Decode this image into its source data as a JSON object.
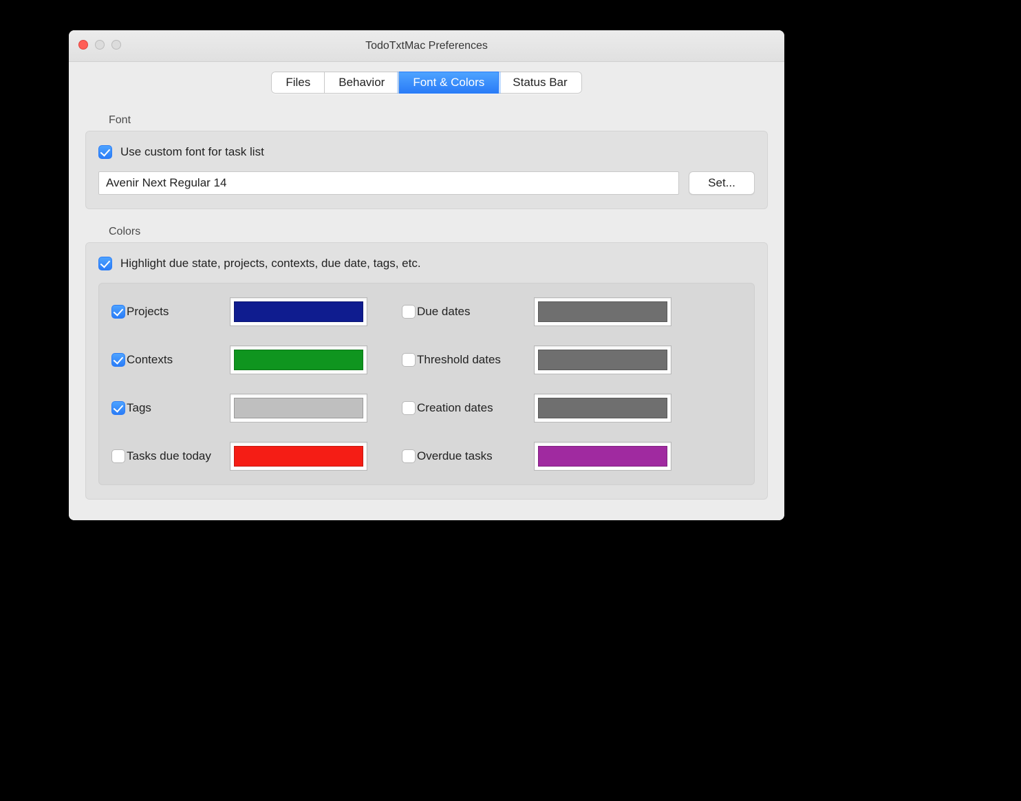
{
  "window": {
    "title": "TodoTxtMac Preferences"
  },
  "tabs": {
    "files": "Files",
    "behavior": "Behavior",
    "font_colors": "Font & Colors",
    "status_bar": "Status Bar",
    "active": "font_colors"
  },
  "font_section": {
    "heading": "Font",
    "use_custom_label": "Use custom font for task list",
    "use_custom_checked": true,
    "font_value": "Avenir Next Regular 14",
    "set_button": "Set..."
  },
  "colors_section": {
    "heading": "Colors",
    "highlight_label": "Highlight due state, projects, contexts, due date, tags, etc.",
    "highlight_checked": true,
    "items": {
      "projects": {
        "label": "Projects",
        "checked": true,
        "color": "#0f1c8f"
      },
      "contexts": {
        "label": "Contexts",
        "checked": true,
        "color": "#0f951f"
      },
      "tags": {
        "label": "Tags",
        "checked": true,
        "color": "#bfbfbf"
      },
      "tasks_due_today": {
        "label": "Tasks due today",
        "checked": false,
        "color": "#f51d15"
      },
      "due_dates": {
        "label": "Due dates",
        "checked": false,
        "color": "#6f6f6f"
      },
      "threshold_dates": {
        "label": "Threshold dates",
        "checked": false,
        "color": "#6f6f6f"
      },
      "creation_dates": {
        "label": "Creation dates",
        "checked": false,
        "color": "#6f6f6f"
      },
      "overdue_tasks": {
        "label": "Overdue tasks",
        "checked": false,
        "color": "#a02aa0"
      }
    }
  }
}
